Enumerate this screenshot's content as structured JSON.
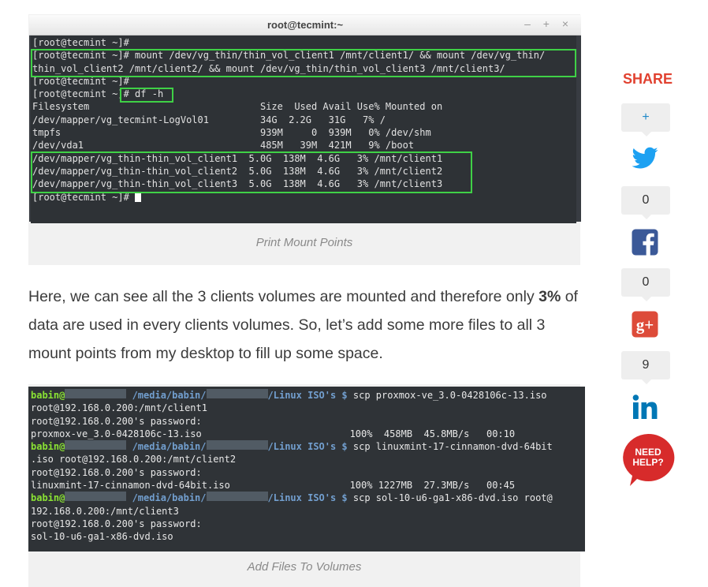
{
  "figure1": {
    "window_title": "root@tecmint:~",
    "window_controls": "– + ×",
    "lines": [
      "[root@tecmint ~]#",
      "[root@tecmint ~]# mount /dev/vg_thin/thin_vol_client1 /mnt/client1/ && mount /dev/vg_thin/",
      "thin_vol_client2 /mnt/client2/ && mount /dev/vg_thin/thin_vol_client3 /mnt/client3/",
      "[root@tecmint ~]#",
      "[root@tecmint ~]# df -h",
      "Filesystem                              Size  Used Avail Use% Mounted on",
      "/dev/mapper/vg_tecmint-LogVol01         34G  2.2G   31G   7% /",
      "tmpfs                                   939M     0  939M   0% /dev/shm",
      "/dev/vda1                               485M   39M  421M   9% /boot",
      "/dev/mapper/vg_thin-thin_vol_client1  5.0G  138M  4.6G   3% /mnt/client1",
      "/dev/mapper/vg_thin-thin_vol_client2  5.0G  138M  4.6G   3% /mnt/client2",
      "/dev/mapper/vg_thin-thin_vol_client3  5.0G  138M  4.6G   3% /mnt/client3"
    ],
    "last_prompt": "[root@tecmint ~]# ",
    "caption": "Print Mount Points"
  },
  "paragraph": {
    "before": "Here, we can see all the 3 clients volumes are mounted and therefore only ",
    "bold": "3%",
    "after": " of data are used in every clients volumes. So, let’s add some more files to all 3 mount points from my desktop to fill up some space."
  },
  "figure2": {
    "user": "babin@",
    "path1": " /media/babin/",
    "path2": "/Linux ISO's $",
    "cmd1": " scp proxmox-ve_3.0-0428106c-13.iso",
    "cmd1b": "root@192.168.0.200:/mnt/client1",
    "pw1": "root@192.168.0.200's password:",
    "xfer1": "proxmox-ve_3.0-0428106c-13.iso                          100%  458MB  45.8MB/s   00:10",
    "cmd2": " scp linuxmint-17-cinnamon-dvd-64bit",
    "cmd2b": ".iso root@192.168.0.200:/mnt/client2",
    "pw2": "root@192.168.0.200's password:",
    "xfer2": "linuxmint-17-cinnamon-dvd-64bit.iso                     100% 1227MB  27.3MB/s   00:45",
    "cmd3": " scp sol-10-u6-ga1-x86-dvd.iso root@",
    "cmd3b": "192.168.0.200:/mnt/client3",
    "pw3": "root@192.168.0.200's password:",
    "xfer3": "sol-10-u6-ga1-x86-dvd.iso",
    "caption": "Add Files To Volumes"
  },
  "share": {
    "title": "SHARE",
    "plus": "+",
    "twitter_count": "0",
    "facebook_count": "0",
    "googleplus_count": "9",
    "help_line1": "NEED",
    "help_line2": "HELP?"
  },
  "colors": {
    "share_red": "#e14130",
    "twitter": "#1da1f2",
    "facebook": "#3b5998",
    "googleplus": "#dd4b39",
    "linkedin": "#0077b5",
    "highlight_green": "#3fd146"
  }
}
